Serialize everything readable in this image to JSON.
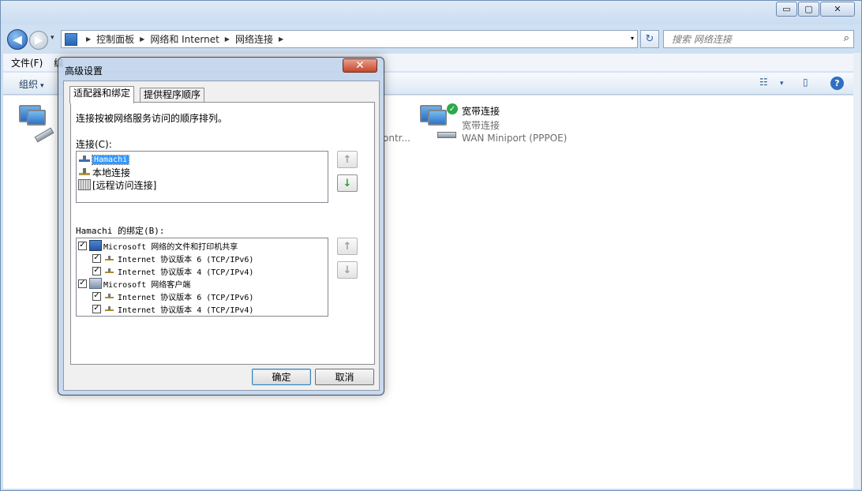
{
  "window": {
    "controls": {
      "minimize": "▭",
      "maximize": "▢",
      "close": "✕"
    },
    "nav": {
      "back": "◀",
      "forward": "▶",
      "history": "▾"
    },
    "address": {
      "crumbs": [
        "控制面板",
        "网络和 Internet",
        "网络连接"
      ],
      "dropdown": "▾"
    },
    "refresh": "↻",
    "search": {
      "placeholder": "搜索 网络连接",
      "icon": "⌕"
    },
    "menu": {
      "file": "文件(F)",
      "partial": "编"
    },
    "toolbar": {
      "organize": "组织",
      "organize_arrow": "▾",
      "view_icon": "☷",
      "view_arrow": "▾",
      "pane_icon": "▯",
      "help_icon": "?"
    },
    "items": [
      {
        "name": "",
        "status": "",
        "device": ""
      },
      {
        "name": "",
        "status": "",
        "device": "ontr..."
      },
      {
        "name": "宽带连接",
        "status": "宽带连接",
        "device": "WAN Miniport (PPPOE)"
      }
    ]
  },
  "dialog": {
    "title": "高级设置",
    "close_symbol": "✕",
    "tabs": [
      "适配器和绑定",
      "提供程序顺序"
    ],
    "description": "连接按被网络服务访问的顺序排列。",
    "connections_label": "连接(C):",
    "connections": [
      "Hamachi",
      "本地连接",
      "[远程访问连接]"
    ],
    "bindings_label": "Hamachi 的绑定(B):",
    "bindings": [
      {
        "text": "Microsoft 网络的文件和打印机共享",
        "checked": true,
        "level": 0
      },
      {
        "text": "Internet 协议版本 6 (TCP/IPv6)",
        "checked": true,
        "level": 1
      },
      {
        "text": "Internet 协议版本 4 (TCP/IPv4)",
        "checked": true,
        "level": 1
      },
      {
        "text": "Microsoft 网络客户端",
        "checked": true,
        "level": 0
      },
      {
        "text": "Internet 协议版本 6 (TCP/IPv6)",
        "checked": true,
        "level": 1
      },
      {
        "text": "Internet 协议版本 4 (TCP/IPv4)",
        "checked": true,
        "level": 1
      }
    ],
    "move_up": "↑",
    "move_down": "↓",
    "ok": "确定",
    "cancel": "取消"
  }
}
